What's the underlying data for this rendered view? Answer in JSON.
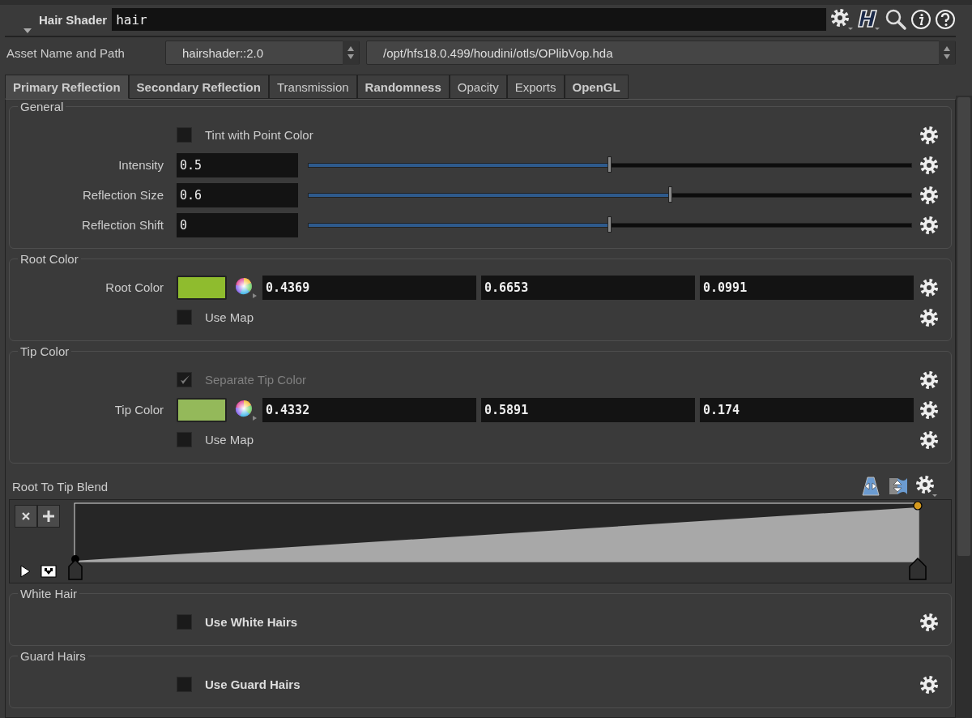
{
  "header": {
    "title": "Hair Shader",
    "name": "hair"
  },
  "asset": {
    "label": "Asset Name and Path",
    "name": "hairshader::2.0",
    "path": "/opt/hfs18.0.499/houdini/otls/OPlibVop.hda"
  },
  "tabs": [
    {
      "label": "Primary Reflection",
      "selected": true,
      "modified": true
    },
    {
      "label": "Secondary Reflection",
      "selected": false,
      "modified": true
    },
    {
      "label": "Transmission",
      "selected": false,
      "modified": false
    },
    {
      "label": "Randomness",
      "selected": false,
      "modified": true
    },
    {
      "label": "Opacity",
      "selected": false,
      "modified": false
    },
    {
      "label": "Exports",
      "selected": false,
      "modified": false
    },
    {
      "label": "OpenGL",
      "selected": false,
      "modified": true
    }
  ],
  "sections": [
    {
      "kind": "group",
      "title": "General",
      "rows": [
        {
          "kind": "checkbox",
          "label": "Tint with Point Color",
          "checked": false,
          "disabled": false,
          "modified": false
        },
        {
          "kind": "slider",
          "label": "Intensity",
          "value": "0.5",
          "level": 0.5
        },
        {
          "kind": "slider",
          "label": "Reflection Size",
          "value": "0.6",
          "level": 0.6
        },
        {
          "kind": "slider",
          "label": "Reflection Shift",
          "value": "0",
          "level": 0.5
        }
      ]
    },
    {
      "kind": "group",
      "title": "Root Color",
      "rows": [
        {
          "kind": "color",
          "label": "Root Color",
          "color": "#8fbc2e",
          "values": [
            "0.4369",
            "0.6653",
            "0.0991"
          ]
        },
        {
          "kind": "checkbox",
          "label": "Use Map",
          "checked": false,
          "disabled": false,
          "modified": false
        }
      ]
    },
    {
      "kind": "group",
      "title": "Tip Color",
      "rows": [
        {
          "kind": "checkbox",
          "label": "Separate Tip Color",
          "checked": true,
          "disabled": true,
          "modified": false
        },
        {
          "kind": "color",
          "label": "Tip Color",
          "color": "#94b95a",
          "values": [
            "0.4332",
            "0.5891",
            "0.174"
          ]
        },
        {
          "kind": "checkbox",
          "label": "Use Map",
          "checked": false,
          "disabled": false,
          "modified": false
        }
      ]
    },
    {
      "kind": "ramp",
      "title": "Root To Tip Blend"
    },
    {
      "kind": "group",
      "title": "White Hair",
      "rows": [
        {
          "kind": "checkbox",
          "label": "Use White Hairs",
          "checked": false,
          "disabled": false,
          "modified": true
        }
      ]
    },
    {
      "kind": "group",
      "title": "Guard Hairs",
      "rows": [
        {
          "kind": "checkbox",
          "label": "Use Guard Hairs",
          "checked": false,
          "disabled": false,
          "modified": true
        }
      ]
    }
  ]
}
